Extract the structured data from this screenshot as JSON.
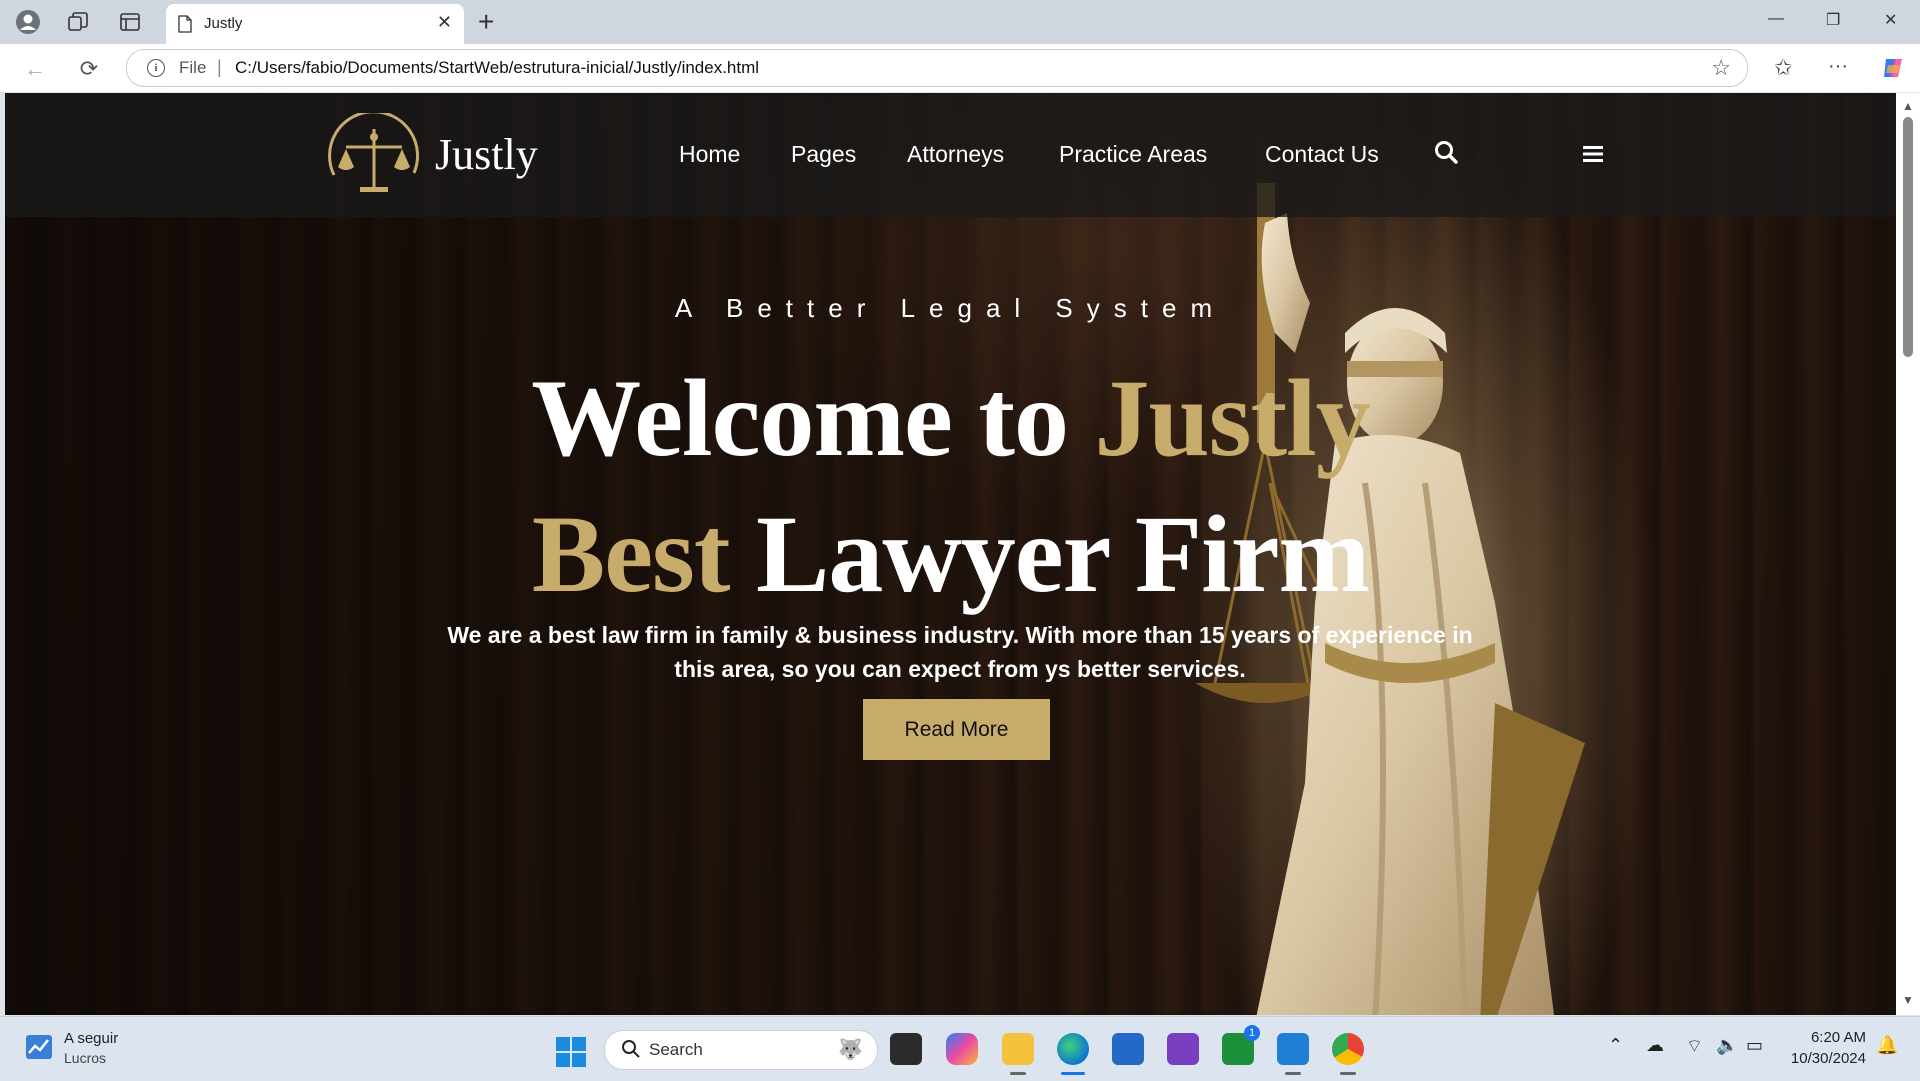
{
  "browser": {
    "tab_title": "Justly",
    "file_label": "File",
    "url": "C:/Users/fabio/Documents/StartWeb/estrutura-inicial/Justly/index.html"
  },
  "site": {
    "logo_text": "Justly",
    "nav": [
      "Home",
      "Pages",
      "Attorneys",
      "Practice Areas",
      "Contact Us"
    ],
    "eyebrow": "A Better Legal System",
    "headline_line1_a": "Welcome to ",
    "headline_line1_b": "Justly",
    "headline_line2_a": "Best",
    "headline_line2_b": " Lawyer Firm",
    "lead": "We are a best law firm in family & business industry. With more than 15 years of experience in this area, so you can expect from ys better services.",
    "cta": "Read More",
    "accent_color": "#c7ac6c"
  },
  "taskbar": {
    "widget_title": "A seguir",
    "widget_sub": "Lucros",
    "search_label": "Search",
    "time": "6:20 AM",
    "date": "10/30/2024",
    "badge": "1"
  }
}
